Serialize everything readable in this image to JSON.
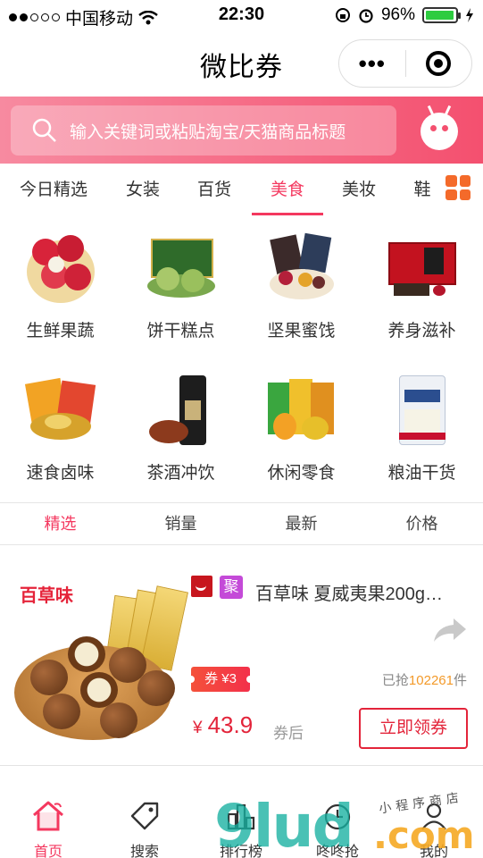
{
  "status_bar": {
    "carrier": "中国移动",
    "time": "22:30",
    "battery": "96%",
    "battery_level": 0.96
  },
  "navbar": {
    "title": "微比券",
    "more_label": "•••"
  },
  "search": {
    "placeholder": "输入关键词或粘贴淘宝/天猫商品标题"
  },
  "tabs": [
    {
      "label": "今日精选"
    },
    {
      "label": "女装"
    },
    {
      "label": "百货"
    },
    {
      "label": "美食",
      "active": true
    },
    {
      "label": "美妆"
    },
    {
      "label": "鞋"
    }
  ],
  "categories": [
    {
      "label": "生鲜果蔬",
      "icon": "lychee-fruit-icon"
    },
    {
      "label": "饼干糕点",
      "icon": "pastry-box-icon"
    },
    {
      "label": "坚果蜜饯",
      "icon": "dried-fruit-icon"
    },
    {
      "label": "养身滋补",
      "icon": "gift-box-icon"
    },
    {
      "label": "速食卤味",
      "icon": "instant-food-icon"
    },
    {
      "label": "茶酒冲饮",
      "icon": "tea-can-icon"
    },
    {
      "label": "休闲零食",
      "icon": "snack-bag-icon"
    },
    {
      "label": "粮油干货",
      "icon": "rice-bag-icon"
    }
  ],
  "sort": [
    {
      "label": "精选",
      "active": true
    },
    {
      "label": "销量"
    },
    {
      "label": "最新"
    },
    {
      "label": "价格"
    }
  ],
  "product": {
    "brand": "百草味",
    "platform_badge": "聚",
    "title": "百草味 夏威夷果200g…",
    "coupon": "券 ¥3",
    "sold_prefix": "已抢",
    "sold_count": "102261",
    "sold_suffix": "件",
    "currency": "¥",
    "price": "43.9",
    "price_note": "券后",
    "button": "立即领券"
  },
  "tabbar": [
    {
      "label": "首页",
      "icon": "home-icon",
      "active": true
    },
    {
      "label": "搜索",
      "icon": "tag-icon"
    },
    {
      "label": "排行榜",
      "icon": "ranking-icon"
    },
    {
      "label": "咚咚抢",
      "icon": "clock-icon"
    },
    {
      "label": "我的",
      "icon": "user-icon"
    }
  ],
  "watermark": {
    "logo": "9lud",
    "domain": ".com",
    "text": "小程序商店"
  },
  "colors": {
    "accent": "#f4385f",
    "price": "#e3243a",
    "sold_number": "#f39a2a"
  }
}
